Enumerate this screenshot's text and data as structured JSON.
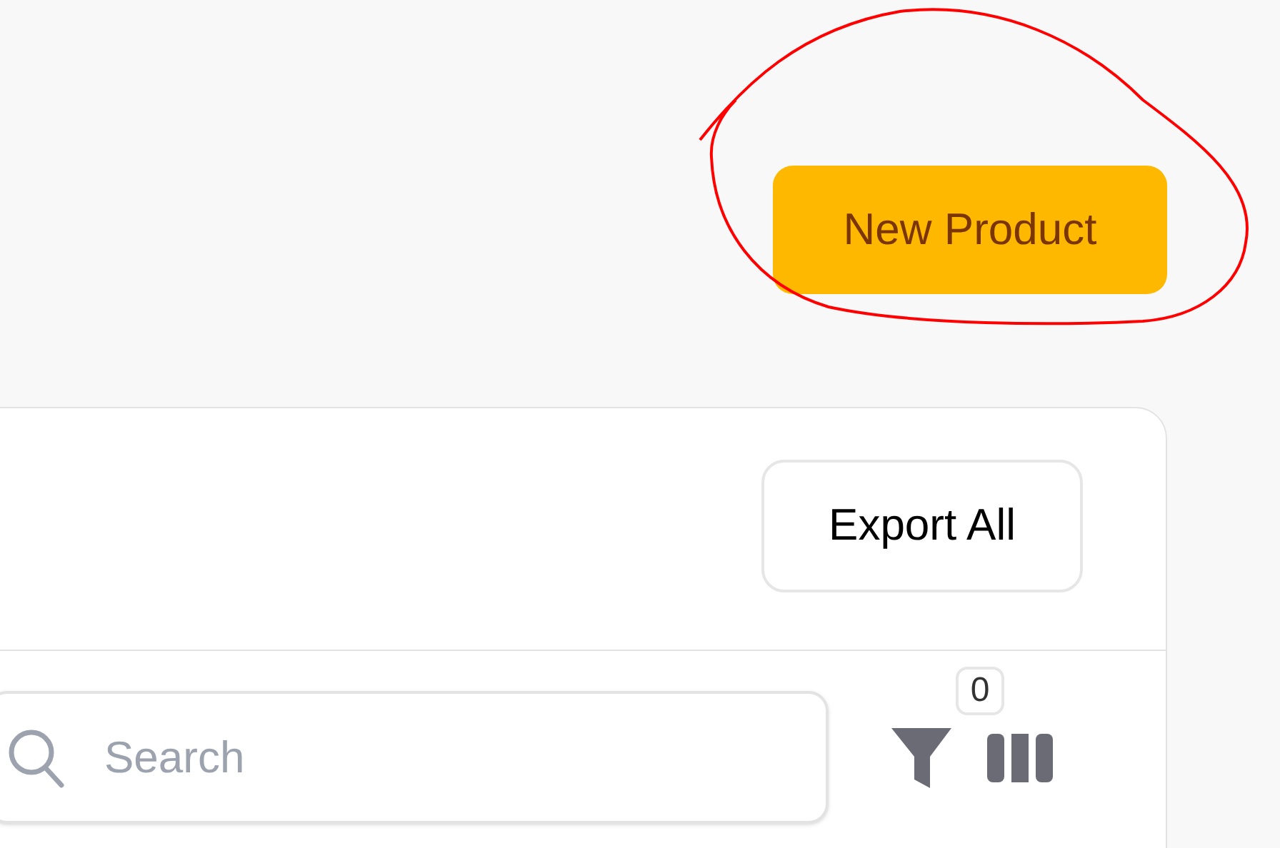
{
  "header": {
    "new_button": "New Product"
  },
  "card": {
    "export_button": "Export All",
    "search": {
      "placeholder": "Search"
    },
    "filter": {
      "count": "0"
    }
  },
  "annotation": {
    "kind": "circle"
  }
}
